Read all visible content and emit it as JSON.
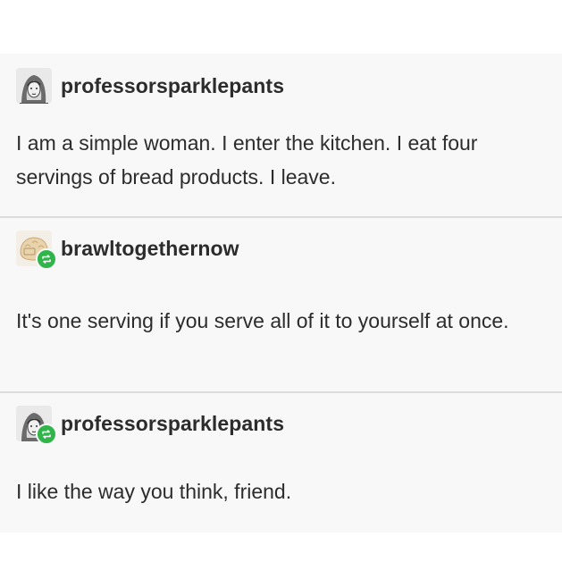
{
  "posts": [
    {
      "username": "professorsparklepants",
      "text": "I am a simple woman. I enter the kitchen. I eat four servings of bread products. I leave.",
      "avatar_icon": "sketch-portrait-avatar",
      "reblogged": false
    },
    {
      "username": "brawltogethernow",
      "text": "It's one serving if you serve all of it to yourself at once.",
      "avatar_icon": "bread-avatar",
      "reblogged": true
    },
    {
      "username": "professorsparklepants",
      "text": "I like the way you think, friend.",
      "avatar_icon": "sketch-portrait-avatar",
      "reblogged": true
    }
  ],
  "colors": {
    "reblog_badge": "#2fb54a",
    "post_background": "#f8f8f8",
    "divider": "#dcdcdc",
    "text": "#2c2c2c"
  }
}
